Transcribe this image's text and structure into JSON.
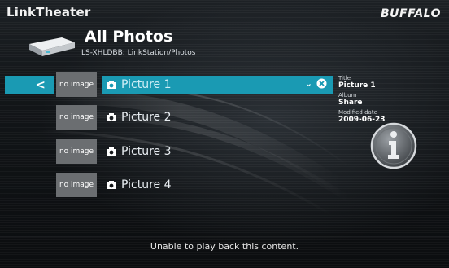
{
  "header": {
    "app_name": "LinkTheater",
    "brand_logo": "BUFFALO",
    "title": "All Photos",
    "path": "LS-XHLDBB: LinkStation/Photos"
  },
  "list": {
    "items": [
      {
        "thumb": "no image",
        "label": "Picture 1",
        "selected": true
      },
      {
        "thumb": "no image",
        "label": "Picture 2",
        "selected": false
      },
      {
        "thumb": "no image",
        "label": "Picture 3",
        "selected": false
      },
      {
        "thumb": "no image",
        "label": "Picture 4",
        "selected": false
      }
    ],
    "icons": {
      "back": "chevron-left-icon",
      "item": "camera-icon",
      "menu": "chevron-down-icon",
      "close": "close-icon"
    }
  },
  "info": {
    "title_key": "Title",
    "title_value": "Picture 1",
    "album_key": "Album",
    "album_value": "Share",
    "date_key": "Modified date",
    "date_value": "2009-06-23",
    "icon": "info-icon"
  },
  "footer": {
    "status": "Unable to play back this content."
  },
  "colors": {
    "accent": "#1a9ab3",
    "thumb_bg": "#6b6e71"
  }
}
